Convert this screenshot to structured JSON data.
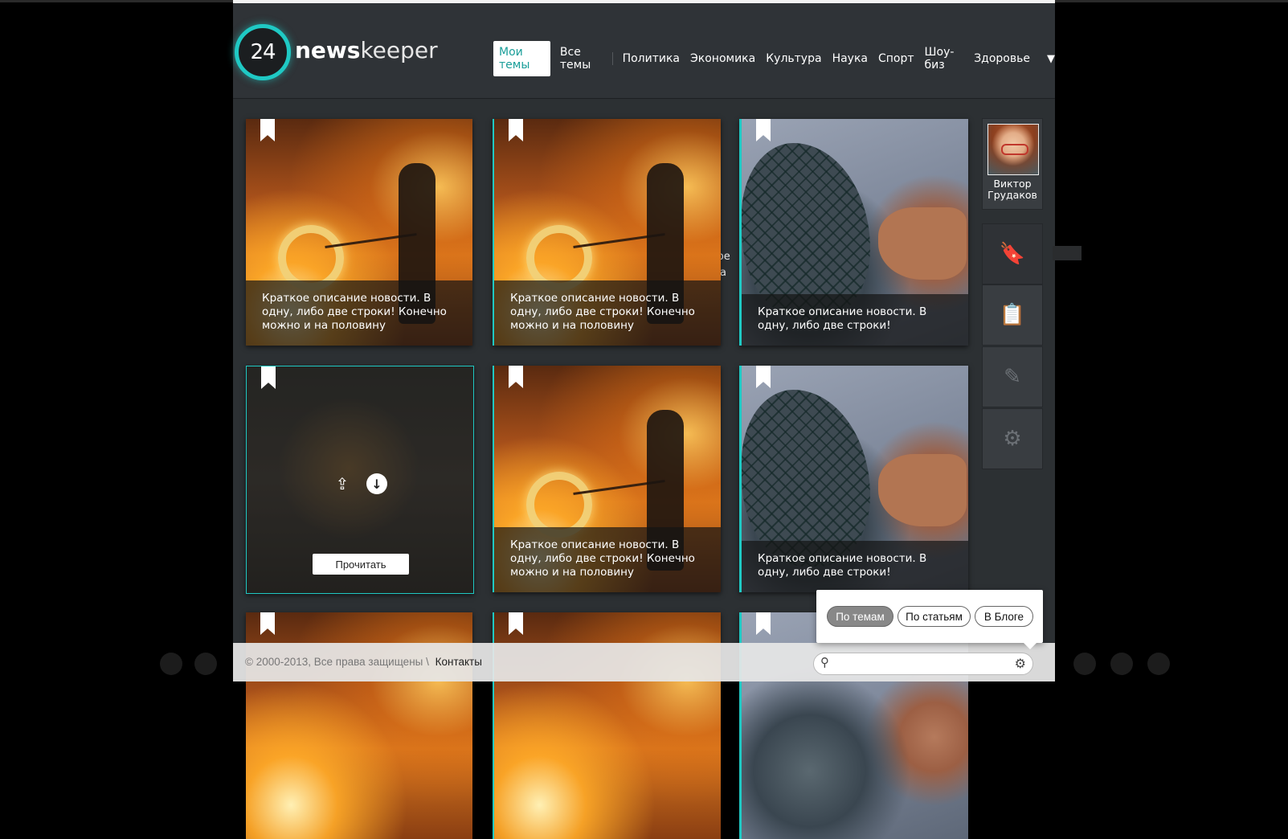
{
  "brand": {
    "number": "24",
    "name_bold": "news",
    "name_light": "keeper"
  },
  "nav": {
    "items": [
      "Мои темы",
      "Все темы",
      "Политика",
      "Экономика",
      "Культура",
      "Наука",
      "Спорт",
      "Шоу-биз",
      "Здоровье"
    ],
    "more_symbol": "▼"
  },
  "cards": [
    {
      "type": "fire",
      "caption": "Краткое описание новости. В одну, либо две строки!  Конечно можно и на половину"
    },
    {
      "type": "fire",
      "caption": "Краткое описание новости. В одну, либо две строки!  Конечно можно и на половину"
    },
    {
      "type": "fish",
      "caption": "Краткое описание новости. В одну, либо две строки!"
    },
    {
      "type": "crowd",
      "read_label": "Прочитать"
    },
    {
      "type": "fire",
      "caption": "Краткое описание новости. В одну, либо две строки!  Конечно можно и на половину"
    },
    {
      "type": "fish",
      "caption": "Краткое описание новости. В одну, либо две строки!"
    }
  ],
  "ghost_text": {
    "line1": "отре",
    "line2": "с ва"
  },
  "profile": {
    "first_name": "Виктор",
    "last_name": "Грудаков"
  },
  "side_buttons": [
    "bookmark-icon",
    "clipboard-icon",
    "pencil-icon",
    "gear-icon"
  ],
  "filter": {
    "options": [
      "По темам",
      "По статьям",
      "В Блоге"
    ],
    "active": "По темам"
  },
  "footer": {
    "copyright": "© 2000-2013, Все права защищены  \\",
    "contacts": "Контакты",
    "search_placeholder": ""
  },
  "colors": {
    "accent": "#1fc9c4",
    "background": "#2c3033",
    "nav_active_text": "#1a9e99"
  }
}
